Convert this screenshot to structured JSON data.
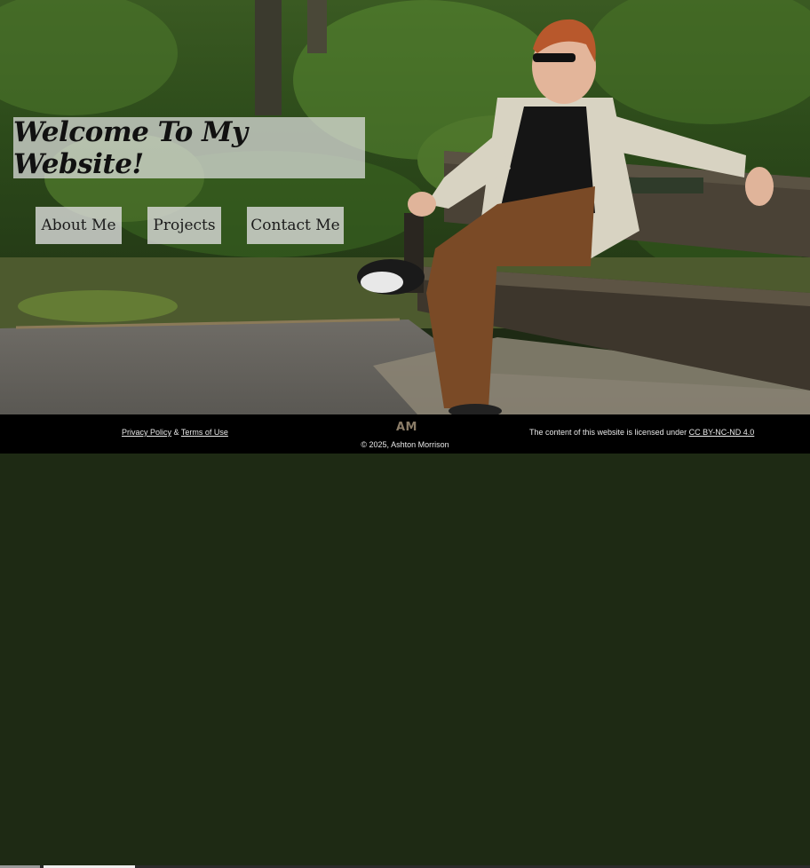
{
  "hero": {
    "title": "Welcome To My Website!"
  },
  "nav": {
    "items": [
      {
        "label": "About Me"
      },
      {
        "label": "Projects"
      },
      {
        "label": "Contact Me"
      }
    ]
  },
  "footer": {
    "privacy_label": "Privacy Policy",
    "ampersand": "&",
    "terms_label": "Terms of Use",
    "logo_text": "AM",
    "copyright": "© 2025, Ashton Morrison",
    "license_prefix": "The content of this website is licensed under",
    "license_link": "CC BY-NC-ND 4.0"
  },
  "colors": {
    "footer_bg": "#000000",
    "overlay_bg": "#e1e1e1",
    "logo": "#8a7c67"
  },
  "background_image": {
    "subject": "red-haired man in sunglasses sitting on a wooden park bench in a green forest"
  }
}
